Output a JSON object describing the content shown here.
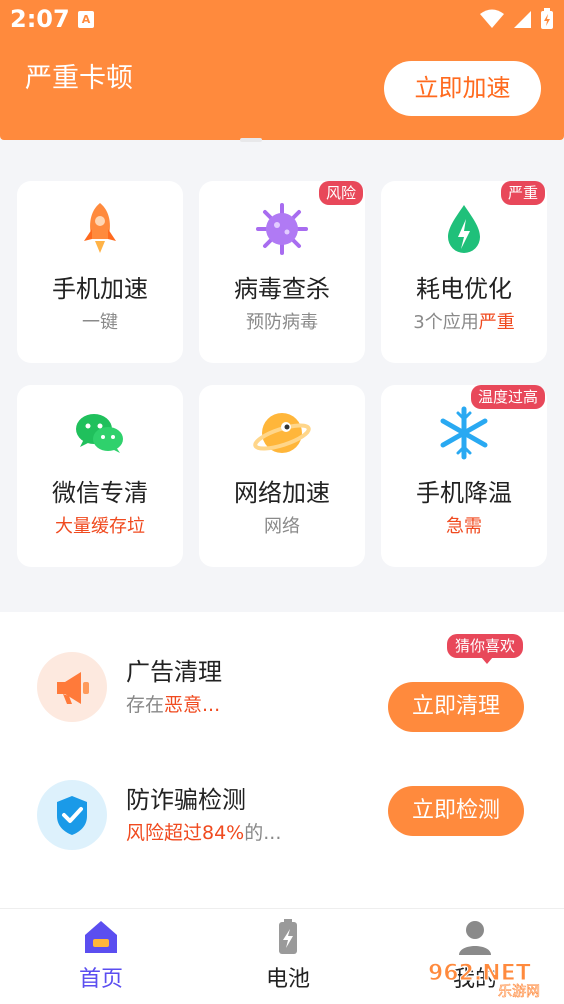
{
  "status_bar": {
    "time": "2:07",
    "notification_glyph": "A"
  },
  "header": {
    "title": "严重卡顿",
    "action_label": "立即加速"
  },
  "grid": [
    {
      "label": "手机加速",
      "sub": "一键",
      "icon": "rocket-icon"
    },
    {
      "label": "病毒查杀",
      "sub": "预防病毒",
      "badge": "风险",
      "icon": "virus-icon"
    },
    {
      "label": "耗电优化",
      "sub_prefix": "3个应用",
      "sub_highlight": "严重",
      "badge": "严重",
      "icon": "battery-drop-icon"
    },
    {
      "label": "微信专清",
      "sub": "大量缓存垃",
      "icon": "wechat-icon"
    },
    {
      "label": "网络加速",
      "sub": "网络",
      "icon": "planet-icon"
    },
    {
      "label": "手机降温",
      "sub": "急需",
      "badge": "温度过高",
      "icon": "snowflake-icon"
    }
  ],
  "list": [
    {
      "title": "广告清理",
      "desc_prefix": "存在",
      "desc_highlight": "恶意...",
      "button": "立即清理",
      "tag": "猜你喜欢",
      "icon": "megaphone-icon"
    },
    {
      "title": "防诈骗检测",
      "desc_highlight": "风险超过84%",
      "desc_suffix": "的...",
      "button": "立即检测",
      "icon": "shield-check-icon"
    }
  ],
  "bottom_nav": [
    {
      "label": "首页",
      "icon": "home-icon",
      "active": true
    },
    {
      "label": "电池",
      "icon": "battery-icon",
      "active": false
    },
    {
      "label": "我的",
      "icon": "user-icon",
      "active": false
    }
  ],
  "watermark": {
    "brand": "962.NET",
    "sub": "乐游网"
  },
  "colors": {
    "primary": "#ff8a3d",
    "alert": "#e8485a",
    "highlight": "#f04a1f",
    "active_nav": "#5b4ef0"
  }
}
